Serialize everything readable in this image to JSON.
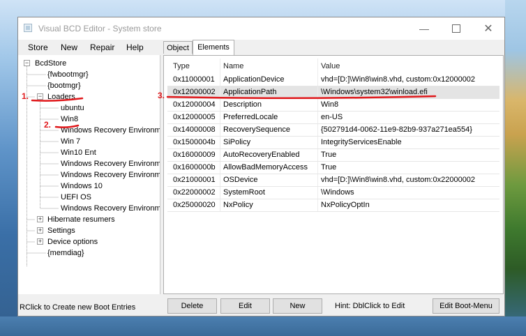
{
  "window": {
    "title": "Visual BCD Editor - System store"
  },
  "menu": [
    "Store",
    "New",
    "Repair",
    "Help"
  ],
  "tree": {
    "root": "BcdStore",
    "items": [
      "{fwbootmgr}",
      "{bootmgr}",
      "Loaders",
      "ubuntu",
      "Win8",
      "Windows Recovery Environme",
      "Win 7",
      "Win10 Ent",
      "Windows Recovery Environme",
      "Windows Recovery Environme",
      "Windows 10",
      "UEFI OS",
      "Windows Recovery Environme",
      "Hibernate resumers",
      "Settings",
      "Device options",
      "{memdiag}"
    ]
  },
  "status_left": "RClick to Create new Boot Entries",
  "tabs": [
    "Object",
    "Elements"
  ],
  "grid": {
    "headers": [
      "Type",
      "Name",
      "Value"
    ],
    "rows": [
      [
        "0x11000001",
        "ApplicationDevice",
        "vhd=[D:]\\Win8\\win8.vhd, custom:0x12000002"
      ],
      [
        "0x12000002",
        "ApplicationPath",
        "\\Windows\\system32\\winload.efi"
      ],
      [
        "0x12000004",
        "Description",
        "Win8"
      ],
      [
        "0x12000005",
        "PreferredLocale",
        "en-US"
      ],
      [
        "0x14000008",
        "RecoverySequence",
        "{502791d4-0062-11e9-82b9-937a271ea554}"
      ],
      [
        "0x1500004b",
        "SiPolicy",
        "IntegrityServicesEnable"
      ],
      [
        "0x16000009",
        "AutoRecoveryEnabled",
        "True"
      ],
      [
        "0x1600000b",
        "AllowBadMemoryAccess",
        "True"
      ],
      [
        "0x21000001",
        "OSDevice",
        "vhd=[D:]\\Win8\\win8.vhd, custom:0x22000002"
      ],
      [
        "0x22000002",
        "SystemRoot",
        "\\Windows"
      ],
      [
        "0x25000020",
        "NxPolicy",
        "NxPolicyOptIn"
      ]
    ]
  },
  "buttons": {
    "delete": "Delete",
    "edit": "Edit",
    "new": "New",
    "edit_boot_menu": "Edit Boot-Menu"
  },
  "hint": "Hint: DblClick to Edit",
  "annotations": [
    "1.",
    "2.",
    "3."
  ],
  "colors": {
    "annotation": "#e0181b",
    "selected_row": "#e4e4e4"
  }
}
